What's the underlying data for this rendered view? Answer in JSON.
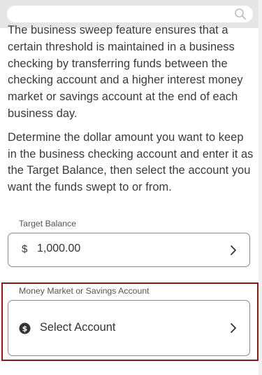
{
  "description": {
    "paragraph1": "The business sweep feature ensures that a certain threshold is maintained in a business checking by transferring funds between the checking account and a higher interest money market or savings account at the end of each business day.",
    "paragraph2": "Determine the dollar amount you want to keep in the business checking account and enter it as the Target Balance, then select the account you want the funds swept to or from."
  },
  "target_balance": {
    "label": "Target Balance",
    "currency_symbol": "$",
    "value": "1,000.00"
  },
  "account_select": {
    "label": "Money Market or Savings Account",
    "placeholder": "Select Account",
    "icon": "dollar-circle-icon"
  },
  "colors": {
    "highlight_border": "#8b1a1a",
    "field_border": "#8a8a8a",
    "top_bar": "#e6e6e6"
  }
}
